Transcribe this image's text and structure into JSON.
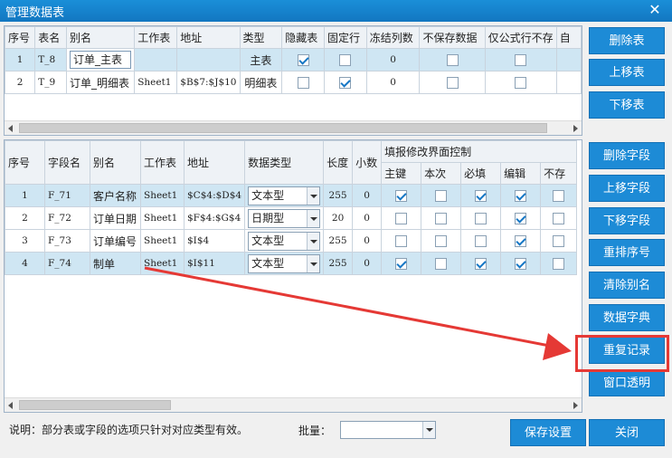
{
  "window": {
    "title": "管理数据表",
    "close_glyph": "✕"
  },
  "table_grid": {
    "columns": [
      "序号",
      "表名",
      "别名",
      "工作表",
      "地址",
      "类型",
      "隐藏表",
      "固定行",
      "冻结列数",
      "不保存数据",
      "仅公式行不存",
      "自"
    ],
    "rows": [
      {
        "index": "1",
        "name": "T_8",
        "alias": "订单_主表",
        "sheet": "",
        "address": "",
        "type": "主表",
        "hidden": true,
        "fixed": false,
        "freeze": "0",
        "nosave": false,
        "formula": false
      },
      {
        "index": "2",
        "name": "T_9",
        "alias": "订单_明细表",
        "sheet": "Sheet1",
        "address": "$B$7:$J$10",
        "type": "明细表",
        "hidden": false,
        "fixed": true,
        "freeze": "0",
        "nosave": false,
        "formula": false
      }
    ]
  },
  "field_grid": {
    "columns": [
      "序号",
      "字段名",
      "别名",
      "工作表",
      "地址",
      "数据类型",
      "长度",
      "小数"
    ],
    "group_header": "填报修改界面控制",
    "sub_columns": [
      "主键",
      "本次",
      "必填",
      "编辑",
      "不存"
    ],
    "rows": [
      {
        "index": "1",
        "name": "F_71",
        "alias": "客户名称",
        "sheet": "Sheet1",
        "address": "$C$4:$D$4",
        "dtype": "文本型",
        "length": "255",
        "decimals": "0",
        "flags": [
          true,
          false,
          true,
          true,
          false
        ],
        "selected": true
      },
      {
        "index": "2",
        "name": "F_72",
        "alias": "订单日期",
        "sheet": "Sheet1",
        "address": "$F$4:$G$4",
        "dtype": "日期型",
        "length": "20",
        "decimals": "0",
        "flags": [
          false,
          false,
          false,
          true,
          false
        ],
        "selected": false
      },
      {
        "index": "3",
        "name": "F_73",
        "alias": "订单编号",
        "sheet": "Sheet1",
        "address": "$I$4",
        "dtype": "文本型",
        "length": "255",
        "decimals": "0",
        "flags": [
          false,
          false,
          false,
          true,
          false
        ],
        "selected": false
      },
      {
        "index": "4",
        "name": "F_74",
        "alias": "制单",
        "sheet": "Sheet1",
        "address": "$I$11",
        "dtype": "文本型",
        "length": "255",
        "decimals": "0",
        "flags": [
          true,
          false,
          true,
          true,
          false
        ],
        "selected": true
      }
    ]
  },
  "right_buttons": {
    "delete_table": "删除表",
    "move_up_table": "上移表",
    "move_down_table": "下移表",
    "delete_field": "删除字段",
    "move_up_field": "上移字段",
    "move_down_field": "下移字段",
    "renumber": "重排序号",
    "clear_alias": "清除别名",
    "data_dictionary": "数据字典",
    "duplicate_record": "重复记录",
    "window_transparent": "窗口透明"
  },
  "footer": {
    "note": "说明：部分表或字段的选项只针对对应类型有效。",
    "batch_label": "批量：",
    "batch_value": "",
    "save_button": "保存设置",
    "close_button": "关闭"
  },
  "colors": {
    "accent": "#1d8bd6",
    "highlight": "#e53935",
    "selection": "#cfe6f3"
  }
}
